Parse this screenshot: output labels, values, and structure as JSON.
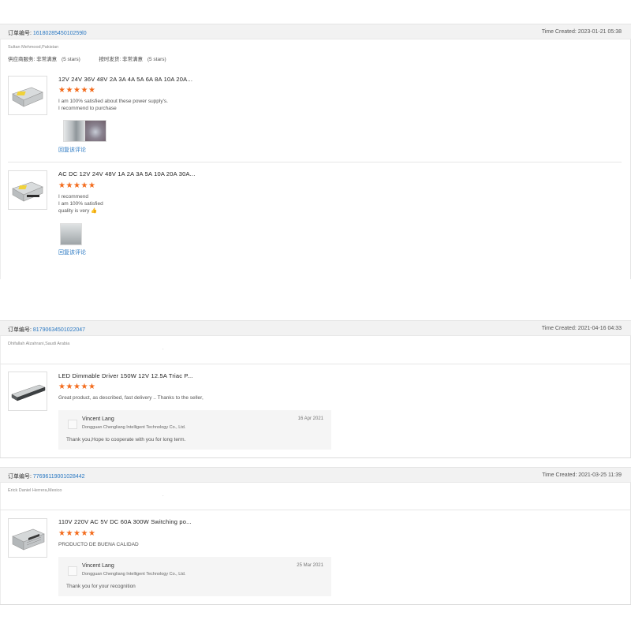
{
  "colors": {
    "accent": "#2a78c2",
    "star": "#f36b1c",
    "header_bg": "#f2f2f2"
  },
  "order_label": "订单编号: ",
  "orders": [
    {
      "number": "1618028545010259l0",
      "time": "Time Created: 2023-01-21 05:38",
      "buyer": "Sultan Mehmood,Pakistan",
      "ratings": {
        "service_label": "供应商服务: 非常满意",
        "service_stars": "(5 stars)",
        "delivery_label": "按时发货: 非常满意",
        "delivery_stars": "(5 stars)"
      },
      "items": [
        {
          "title": "12V 24V 36V 48V 2A 3A 4A 5A 6A 8A 10A 20A...",
          "stars": 5,
          "review_lines": [
            "I am 100% satisfied about these power supply's.",
            "I recommend to purchase"
          ],
          "photo_count": 2,
          "reply_link": "回复该评论"
        },
        {
          "title": "AC DC 12V 24V 48V 1A 2A 3A 5A 10A 20A 30A...",
          "stars": 5,
          "review_lines": [
            "I recommend",
            "I am 100% satisfied",
            "quality is very 👍"
          ],
          "photo_count": 1,
          "reply_link": "回复该评论"
        }
      ]
    },
    {
      "number": "81790634501022047",
      "time": "Time Created: 2021-04-16 04:33",
      "buyer": "Dhifallah Alzahrani,Saudi Arabia",
      "items": [
        {
          "title": "LED Dimmable Driver 150W 12V 12.5A Triac P...",
          "stars": 5,
          "review_lines": [
            "Great product, as described, fast delivery .. Thanks to the seller,"
          ],
          "reply": {
            "name": "Vincent Lang",
            "company": "Dongguan Chengliang Intelligent Technology Co., Ltd.",
            "date": "16 Apr 2021",
            "text": "Thank you,Hope to cooperate with you for long term."
          }
        }
      ]
    },
    {
      "number": "77696119001028442",
      "time": "Time Created: 2021-03-25 11:39",
      "buyer": "Erick Daniel Herrera,Mexico",
      "items": [
        {
          "title": "110V 220V AC 5V DC 60A 300W Switching po...",
          "stars": 5,
          "review_lines": [
            "PRODUCTO DE BUENA CALIDAD"
          ],
          "reply": {
            "name": "Vincent Lang",
            "company": "Dongguan Chengliang Intelligent Technology Co., Ltd.",
            "date": "25 Mar 2021",
            "text": "Thank you for your recognition"
          }
        }
      ]
    }
  ]
}
